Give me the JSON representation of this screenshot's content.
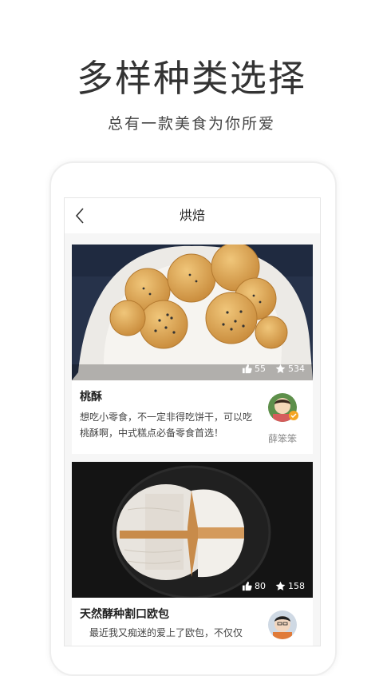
{
  "hero": {
    "title": "多样种类选择",
    "subtitle": "总有一款美食为你所爱"
  },
  "nav": {
    "title": "烘焙",
    "back_icon": "chevron-left-icon"
  },
  "recipes": [
    {
      "title": "桃酥",
      "description": "想吃小零食，不一定非得吃饼干，可以吃桃酥啊，中式糕点必备零食首选！",
      "likes": "55",
      "favorites": "534",
      "author": "薛笨笨"
    },
    {
      "title": "天然酵种割口欧包",
      "description": "最近我又痴迷的爱上了欧包，不仅仅",
      "likes": "80",
      "favorites": "158",
      "author": ""
    }
  ],
  "colors": {
    "verified_badge": "#f5a623",
    "background": "#ffffff"
  }
}
